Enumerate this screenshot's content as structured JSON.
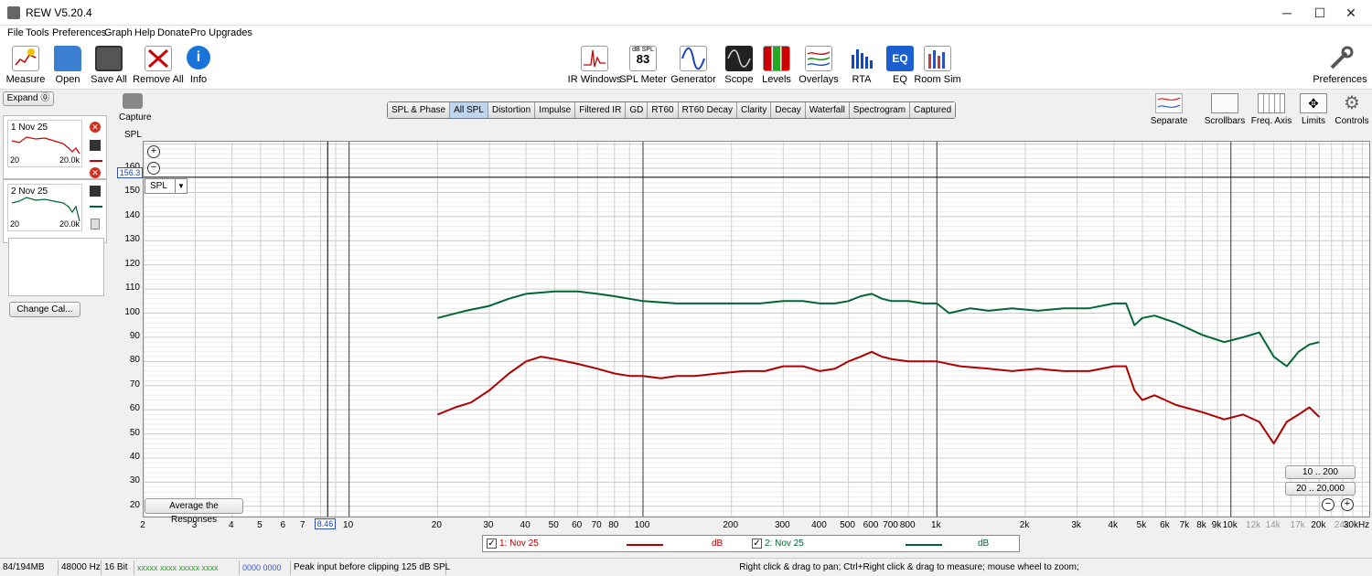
{
  "window": {
    "title": "REW V5.20.4",
    "minimize": "─",
    "maximize": "☐",
    "close": "✕"
  },
  "menu": [
    "File",
    "Tools",
    "Preferences",
    "Graph",
    "Help",
    "Donate",
    "Pro Upgrades"
  ],
  "toolbar_left": [
    {
      "label": "Measure",
      "icon": "measure-icon"
    },
    {
      "label": "Open",
      "icon": "folder-icon"
    },
    {
      "label": "Save All",
      "icon": "save-icon"
    },
    {
      "label": "Remove All",
      "icon": "remove-icon"
    },
    {
      "label": "Info",
      "icon": "info-icon"
    }
  ],
  "toolbar_center": [
    {
      "label": "IR Windows",
      "icon": "ir-windows-icon"
    },
    {
      "label": "SPL Meter",
      "icon": "spl-meter-icon",
      "top_text": "dB SPL",
      "big_text": "83"
    },
    {
      "label": "Generator",
      "icon": "generator-icon"
    },
    {
      "label": "Scope",
      "icon": "scope-icon"
    },
    {
      "label": "Levels",
      "icon": "levels-icon"
    },
    {
      "label": "Overlays",
      "icon": "overlays-icon"
    },
    {
      "label": "RTA",
      "icon": "rta-icon"
    },
    {
      "label": "EQ",
      "icon": "eq-icon",
      "top_text": "EQ"
    },
    {
      "label": "Room Sim",
      "icon": "room-sim-icon"
    }
  ],
  "toolbar_right": {
    "label": "Preferences",
    "icon": "wrench-icon"
  },
  "left_panel": {
    "expand": "Expand",
    "capture": "Capture",
    "measurements": [
      {
        "num": "1",
        "name": "Nov 25",
        "x_start": "20",
        "x_end": "20.0k",
        "color": "#c00000"
      },
      {
        "num": "2",
        "name": "Nov 25",
        "x_start": "20",
        "x_end": "20.0k",
        "color": "#006633"
      }
    ],
    "change_cal": "Change Cal..."
  },
  "tabs": [
    "SPL & Phase",
    "All SPL",
    "Distortion",
    "Impulse",
    "Filtered IR",
    "GD",
    "RT60",
    "RT60 Decay",
    "Clarity",
    "Decay",
    "Waterfall",
    "Spectrogram",
    "Captured"
  ],
  "active_tab": "All SPL",
  "right_tools": [
    {
      "label": "Separate",
      "icon": "separate-icon"
    },
    {
      "label": "Scrollbars",
      "icon": "scrollbars-icon"
    },
    {
      "label": "Freq. Axis",
      "icon": "freq-axis-icon"
    },
    {
      "label": "Limits",
      "icon": "limits-icon"
    },
    {
      "label": "Controls",
      "icon": "gear-icon"
    }
  ],
  "graph": {
    "y_axis_title": "SPL",
    "cursor_y_readout": "156.3",
    "cursor_x_readout": "8.46",
    "y_selector": "SPL",
    "avg_button": "Average the Responses",
    "range1": "10 .. 200",
    "range2": "20 .. 20,000",
    "zoom_in": "⊕",
    "zoom_out": "⊖"
  },
  "chart_data": {
    "type": "line",
    "title": "",
    "xlabel": "",
    "ylabel": "SPL",
    "x_scale": "log",
    "xlim": [
      2,
      30000
    ],
    "ylim": [
      15,
      171
    ],
    "y_ticks": [
      20,
      30,
      40,
      50,
      60,
      70,
      80,
      90,
      100,
      110,
      120,
      130,
      140,
      150,
      160
    ],
    "x_tick_labels": [
      {
        "v": 2,
        "t": "2"
      },
      {
        "v": 3,
        "t": "3"
      },
      {
        "v": 4,
        "t": "4"
      },
      {
        "v": 5,
        "t": "5"
      },
      {
        "v": 6,
        "t": "6"
      },
      {
        "v": 7,
        "t": "7"
      },
      {
        "v": 10,
        "t": "10"
      },
      {
        "v": 20,
        "t": "20"
      },
      {
        "v": 30,
        "t": "30"
      },
      {
        "v": 40,
        "t": "40"
      },
      {
        "v": 50,
        "t": "50"
      },
      {
        "v": 60,
        "t": "60"
      },
      {
        "v": 70,
        "t": "70"
      },
      {
        "v": 80,
        "t": "80"
      },
      {
        "v": 100,
        "t": "100"
      },
      {
        "v": 200,
        "t": "200"
      },
      {
        "v": 300,
        "t": "300"
      },
      {
        "v": 400,
        "t": "400"
      },
      {
        "v": 500,
        "t": "500"
      },
      {
        "v": 600,
        "t": "600"
      },
      {
        "v": 700,
        "t": "700"
      },
      {
        "v": 800,
        "t": "800"
      },
      {
        "v": 1000,
        "t": "1k"
      },
      {
        "v": 2000,
        "t": "2k"
      },
      {
        "v": 3000,
        "t": "3k"
      },
      {
        "v": 4000,
        "t": "4k"
      },
      {
        "v": 5000,
        "t": "5k"
      },
      {
        "v": 6000,
        "t": "6k"
      },
      {
        "v": 7000,
        "t": "7k"
      },
      {
        "v": 8000,
        "t": "8k"
      },
      {
        "v": 9000,
        "t": "9k"
      },
      {
        "v": 10000,
        "t": "10k"
      },
      {
        "v": 12000,
        "t": "12k",
        "dim": true
      },
      {
        "v": 14000,
        "t": "14k",
        "dim": true
      },
      {
        "v": 17000,
        "t": "17k",
        "dim": true
      },
      {
        "v": 20000,
        "t": "20k"
      },
      {
        "v": 24000,
        "t": "24k",
        "dim": true
      },
      {
        "v": 30000,
        "t": "30kHz"
      }
    ],
    "cursor": {
      "x": 8.46,
      "y": 156.3
    },
    "series": [
      {
        "name": "1: Nov 25",
        "unit": "dB",
        "color": "#b00000",
        "points": [
          [
            20,
            58
          ],
          [
            23,
            61
          ],
          [
            26,
            63
          ],
          [
            30,
            68
          ],
          [
            35,
            75
          ],
          [
            40,
            80
          ],
          [
            45,
            82
          ],
          [
            50,
            81
          ],
          [
            60,
            79
          ],
          [
            70,
            77
          ],
          [
            80,
            75
          ],
          [
            90,
            74
          ],
          [
            100,
            74
          ],
          [
            115,
            73
          ],
          [
            130,
            74
          ],
          [
            150,
            74
          ],
          [
            180,
            75
          ],
          [
            220,
            76
          ],
          [
            260,
            76
          ],
          [
            300,
            78
          ],
          [
            350,
            78
          ],
          [
            400,
            76
          ],
          [
            450,
            77
          ],
          [
            500,
            80
          ],
          [
            550,
            82
          ],
          [
            600,
            84
          ],
          [
            650,
            82
          ],
          [
            700,
            81
          ],
          [
            800,
            80
          ],
          [
            900,
            80
          ],
          [
            1000,
            80
          ],
          [
            1200,
            78
          ],
          [
            1500,
            77
          ],
          [
            1800,
            76
          ],
          [
            2200,
            77
          ],
          [
            2700,
            76
          ],
          [
            3300,
            76
          ],
          [
            4000,
            78
          ],
          [
            4400,
            78
          ],
          [
            4700,
            68
          ],
          [
            5000,
            64
          ],
          [
            5500,
            66
          ],
          [
            6500,
            62
          ],
          [
            8000,
            59
          ],
          [
            9500,
            56
          ],
          [
            11000,
            58
          ],
          [
            12500,
            55
          ],
          [
            14000,
            46
          ],
          [
            15500,
            55
          ],
          [
            17000,
            58
          ],
          [
            18500,
            61
          ],
          [
            20000,
            57
          ]
        ]
      },
      {
        "name": "2: Nov 25",
        "unit": "dB",
        "color": "#006633",
        "points": [
          [
            20,
            98
          ],
          [
            25,
            101
          ],
          [
            30,
            103
          ],
          [
            35,
            106
          ],
          [
            40,
            108
          ],
          [
            50,
            109
          ],
          [
            60,
            109
          ],
          [
            70,
            108
          ],
          [
            80,
            107
          ],
          [
            100,
            105
          ],
          [
            130,
            104
          ],
          [
            160,
            104
          ],
          [
            200,
            104
          ],
          [
            250,
            104
          ],
          [
            300,
            105
          ],
          [
            350,
            105
          ],
          [
            400,
            104
          ],
          [
            450,
            104
          ],
          [
            500,
            105
          ],
          [
            550,
            107
          ],
          [
            600,
            108
          ],
          [
            650,
            106
          ],
          [
            700,
            105
          ],
          [
            800,
            105
          ],
          [
            900,
            104
          ],
          [
            1000,
            104
          ],
          [
            1100,
            100
          ],
          [
            1300,
            102
          ],
          [
            1500,
            101
          ],
          [
            1800,
            102
          ],
          [
            2200,
            101
          ],
          [
            2700,
            102
          ],
          [
            3300,
            102
          ],
          [
            4000,
            104
          ],
          [
            4400,
            104
          ],
          [
            4700,
            95
          ],
          [
            5000,
            98
          ],
          [
            5500,
            99
          ],
          [
            6500,
            96
          ],
          [
            8000,
            91
          ],
          [
            9500,
            88
          ],
          [
            11000,
            90
          ],
          [
            12500,
            92
          ],
          [
            14000,
            82
          ],
          [
            15500,
            78
          ],
          [
            17000,
            84
          ],
          [
            18500,
            87
          ],
          [
            20000,
            88
          ]
        ]
      }
    ]
  },
  "status": [
    {
      "text": "84/194MB"
    },
    {
      "text": "48000 Hz"
    },
    {
      "text": "16 Bit"
    },
    {
      "text": "xxxxx xxxx  xxxxx xxxx",
      "color": "#2a9d2a"
    },
    {
      "text": "0000 0000",
      "color": "#3a5bd0"
    },
    {
      "text": "Peak input before clipping 125 dB SPL"
    }
  ],
  "status_hint": "Right click & drag to pan; Ctrl+Right click & drag to measure; mouse wheel to zoom;"
}
